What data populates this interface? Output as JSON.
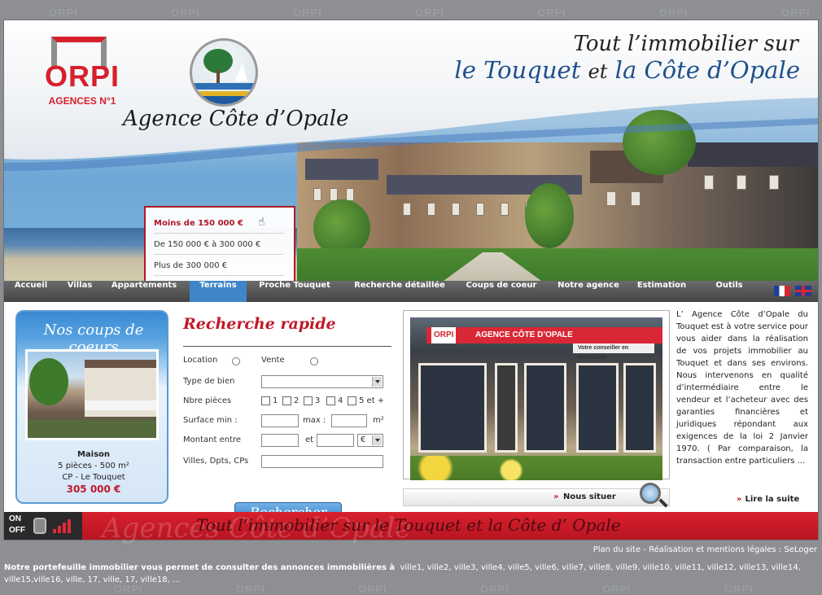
{
  "brand": {
    "logo_word": "ORPI",
    "logo_sub": "AGENCES N°1",
    "watermark": "ORPI",
    "agency_name": "Agence Côte d’Opale",
    "tagline_line1": "Tout l’immobilier sur",
    "tagline_line2_a": "le Touquet",
    "tagline_line2_mid": "et",
    "tagline_line2_b": "la Côte d’Opale"
  },
  "price_filter": {
    "options": [
      "Moins de 150 000 €",
      "De 150 000 € à 300 000 €",
      "Plus de 300 000 €"
    ],
    "active_index": 0
  },
  "nav": {
    "items": [
      "Accueil",
      "Villas",
      "Appartements",
      "Terrains",
      "Proche Touquet",
      "Recherche détaillée",
      "Coups de coeur",
      "Notre agence",
      "Estimation",
      "Outils"
    ],
    "active": "Terrains"
  },
  "coups": {
    "title": "Nos coups de coeurs",
    "type": "Maison",
    "spec": "5 pièces - 500 m²",
    "cp": "CP - Le Touquet",
    "price": "305 000 €"
  },
  "search": {
    "title": "Recherche rapide",
    "location_label": "Location",
    "vente_label": "Vente",
    "type_label": "Type de bien",
    "pieces_label": "Nbre pièces",
    "pieces_options": [
      "1",
      "2",
      "3",
      "4",
      "5 et +"
    ],
    "surface_label": "Surface min :",
    "surface_max_label": "max :",
    "surface_unit": "m²",
    "montant_label": "Montant entre",
    "montant_and": "et",
    "currency": "€",
    "villes_label": "Villes, Dpts, CPs",
    "button": "Rechercher"
  },
  "agency_photo": {
    "sign": "AGENCE CÔTE D’OPALE",
    "sign_logo": "ORPI",
    "sign_sub": "Votre conseiller en immobilier"
  },
  "situer": {
    "label": "Nous situer",
    "chevron": "»"
  },
  "about": {
    "text": "L’ Agence Côte d’Opale du Touquet est à votre service pour vous aider dans la réalisation de vos projets immobilier au Touquet et dans ses environs. Nous intervenons en qualité d’intermédiaire entre le vendeur et l’acheteur avec des garanties financières et juridiques répondant aux exigences de la loi 2 Janvier 1970. ( Par comparaison, la transaction entre particuliers ...",
    "readmore": "Lire la suite",
    "chevron": "»"
  },
  "bottom_band": {
    "watermark": "Agences Côte d’Opale",
    "slogan": "Tout l’immobilier sur le Touquet et la Côte d’ Opale",
    "on": "ON",
    "off": "OFF"
  },
  "footer": {
    "links": "Plan du site - Réalisation et mentions légales : SeLoger",
    "seo_bold": "Notre portefeuille immobilier vous permet de consulter des annonces immobilières à",
    "seo_towns": "ville1, ville2, ville3, ville4, ville5, ville6, ville7, ville8, ville9, ville10, ville11, ville12, ville13, ville14, ville15,ville16, ville, 17, ville, 17, ville18, ..."
  },
  "colors": {
    "brand_red": "#d6202c",
    "nav_active": "#3f86c9",
    "title_blue": "#1f4f8c"
  }
}
